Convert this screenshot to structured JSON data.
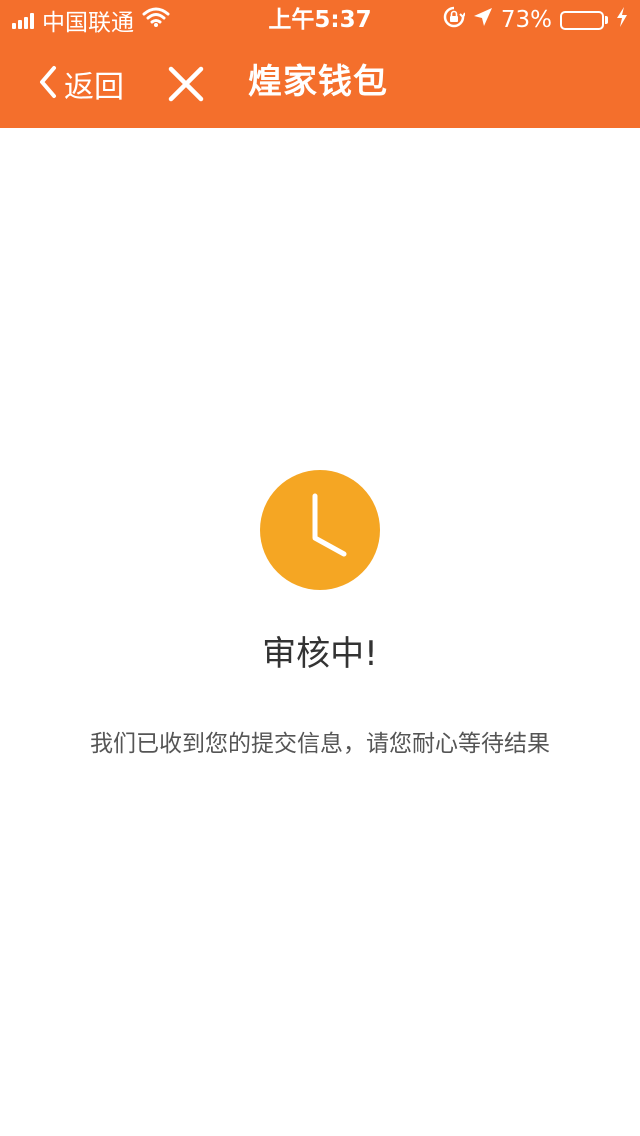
{
  "status_bar": {
    "carrier": "中国联通",
    "time": "上午5:37",
    "battery_percent": "73%",
    "battery_level": 0.73,
    "icons": [
      "signal-icon",
      "wifi-icon",
      "orientation-lock-icon",
      "location-arrow-icon",
      "battery-icon",
      "charging-bolt-icon"
    ]
  },
  "nav": {
    "back_label": "返回",
    "title": "煌家钱包",
    "back_icon": "chevron-left-icon",
    "close_icon": "close-icon"
  },
  "main": {
    "status_icon": "clock-icon",
    "status_title": "审核中!",
    "status_description": "我们已收到您的提交信息，请您耐心等待结果"
  },
  "colors": {
    "header_bg": "#f46f2c",
    "icon_accent": "#f5a623",
    "battery_fill": "#4cd964"
  }
}
